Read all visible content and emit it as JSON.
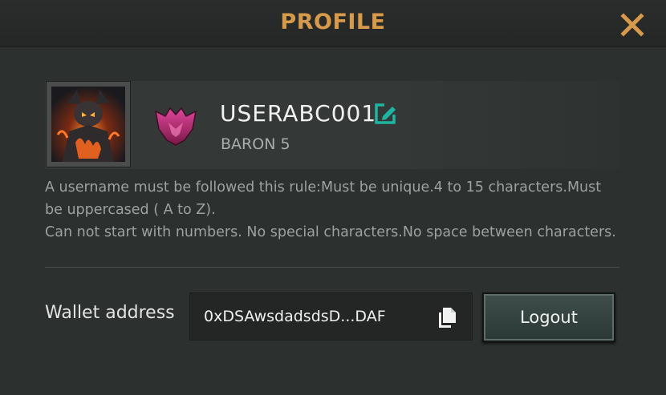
{
  "header": {
    "title": "PROFILE"
  },
  "profile": {
    "username": "USERABC001",
    "rank": "BARON 5",
    "rank_color": "#c2307a"
  },
  "rules": {
    "line1": "A username must be followed this rule:Must be unique.4 to 15 characters.Must be uppercased ( A to Z).",
    "line2": "Can not start with numbers. No special characters.No space between characters."
  },
  "wallet": {
    "label": "Wallet address",
    "value": "0xDSAwsdadsdsD...DAF"
  },
  "actions": {
    "logout_label": "Logout"
  },
  "colors": {
    "title": "#d79a4a",
    "close": "#d79a4a",
    "edit": "#1fb5a3"
  },
  "icons": [
    "close-icon",
    "edit-icon",
    "copy-icon",
    "rank-emblem-icon",
    "avatar-image"
  ]
}
